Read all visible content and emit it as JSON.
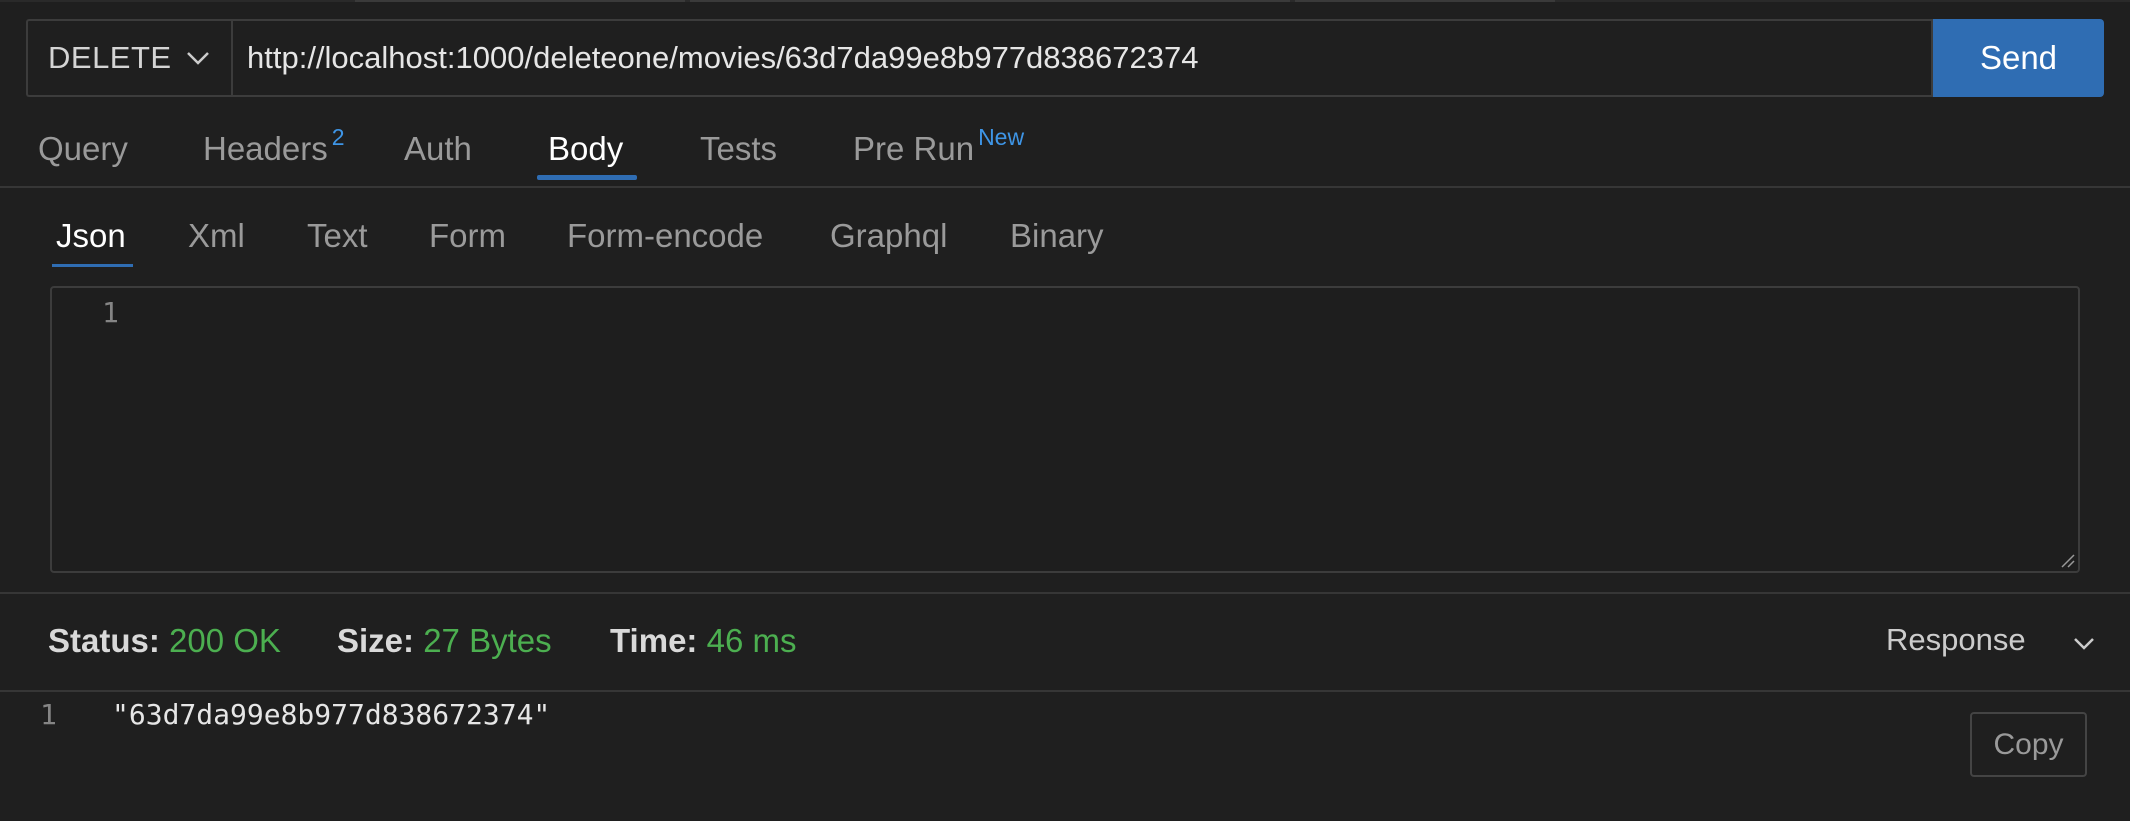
{
  "request": {
    "method": "DELETE",
    "url": "http://localhost:1000/deleteone/movies/63d7da99e8b977d838672374",
    "send_label": "Send"
  },
  "tabs": [
    {
      "label": "Query"
    },
    {
      "label": "Headers",
      "badge": "2"
    },
    {
      "label": "Auth"
    },
    {
      "label": "Body",
      "active": true
    },
    {
      "label": "Tests"
    },
    {
      "label": "Pre Run",
      "badge": "New"
    }
  ],
  "body_tabs": [
    {
      "label": "Json",
      "active": true
    },
    {
      "label": "Xml"
    },
    {
      "label": "Text"
    },
    {
      "label": "Form"
    },
    {
      "label": "Form-encode"
    },
    {
      "label": "Graphql"
    },
    {
      "label": "Binary"
    }
  ],
  "editor": {
    "line_number": "1"
  },
  "status": {
    "status_label": "Status:",
    "status_value": "200 OK",
    "size_label": "Size:",
    "size_value": "27 Bytes",
    "time_label": "Time:",
    "time_value": "46 ms",
    "accent_color": "#4caf50"
  },
  "response": {
    "view_label": "Response",
    "line_number": "1",
    "body": "\"63d7da99e8b977d838672374\"",
    "copy_label": "Copy"
  },
  "colors": {
    "accent": "#2f6db3",
    "badge": "#3e95e6",
    "success": "#4caf50",
    "background": "#1f1f1f"
  }
}
